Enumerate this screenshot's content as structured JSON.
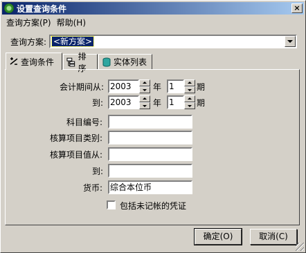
{
  "window": {
    "title": "设置查询条件",
    "close_glyph": "×"
  },
  "menu": [
    "查询方案(P)",
    "帮助(H)"
  ],
  "scheme": {
    "label": "查询方案:",
    "value": "<新方案>"
  },
  "tabs": [
    {
      "label": "查询条件",
      "icon": "filter-icon"
    },
    {
      "label": "排序",
      "icon": "sort-icon"
    },
    {
      "label": "实体列表",
      "icon": "database-icon"
    }
  ],
  "conditions": {
    "period_from_label": "会计期间从:",
    "period_to_label": "到:",
    "year_from": "2003",
    "period_from": "1",
    "year_to": "2003",
    "period_to": "1",
    "year_unit": "年",
    "period_unit": "期",
    "account_code_label": "科目编号:",
    "aux_type_label": "核算项目类别:",
    "aux_from_label": "核算项目值从:",
    "aux_to_label": "到:",
    "currency_label": "货币:",
    "currency_value": "综合本位币",
    "include_unposted_label": "包括未记帐的凭证"
  },
  "buttons": {
    "ok": "确定(O)",
    "cancel": "取消(C)"
  },
  "colors": {
    "title_start": "#0a246a",
    "title_end": "#a6caf0",
    "face": "#d4d0c8"
  }
}
